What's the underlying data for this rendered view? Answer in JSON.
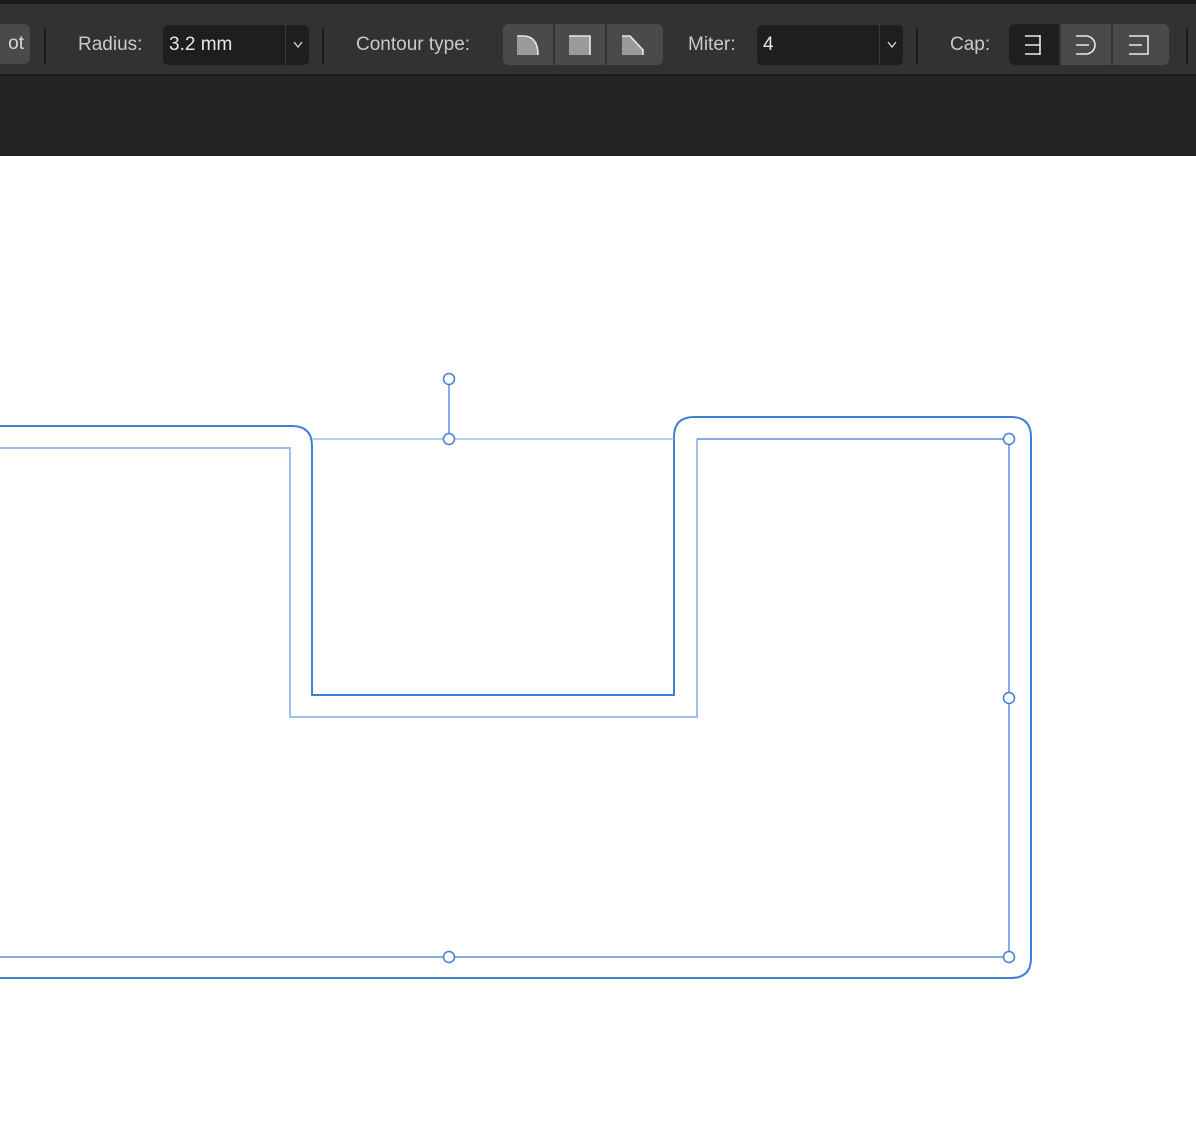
{
  "toolbar": {
    "partial_button_label": "ot",
    "radius": {
      "label": "Radius:",
      "value": "3.2 mm"
    },
    "contour_type": {
      "label": "Contour type:",
      "options": [
        {
          "name": "round",
          "icon": "round-corner-icon"
        },
        {
          "name": "miter",
          "icon": "miter-corner-icon"
        },
        {
          "name": "bevel",
          "icon": "bevel-corner-icon"
        }
      ]
    },
    "miter": {
      "label": "Miter:",
      "value": "4"
    },
    "cap": {
      "label": "Cap:",
      "options": [
        {
          "name": "butt",
          "icon": "butt-cap-icon",
          "selected": true
        },
        {
          "name": "round",
          "icon": "round-cap-icon",
          "selected": false
        },
        {
          "name": "square",
          "icon": "square-cap-icon",
          "selected": false
        }
      ]
    }
  },
  "colors": {
    "toolbar_bg": "#323232",
    "subbar_bg": "#232323",
    "canvas_bg": "#ffffff",
    "contour_stroke": "#3f7fd4",
    "path_stroke": "#9ec0ea",
    "handle_stroke": "#3f7fd4"
  }
}
